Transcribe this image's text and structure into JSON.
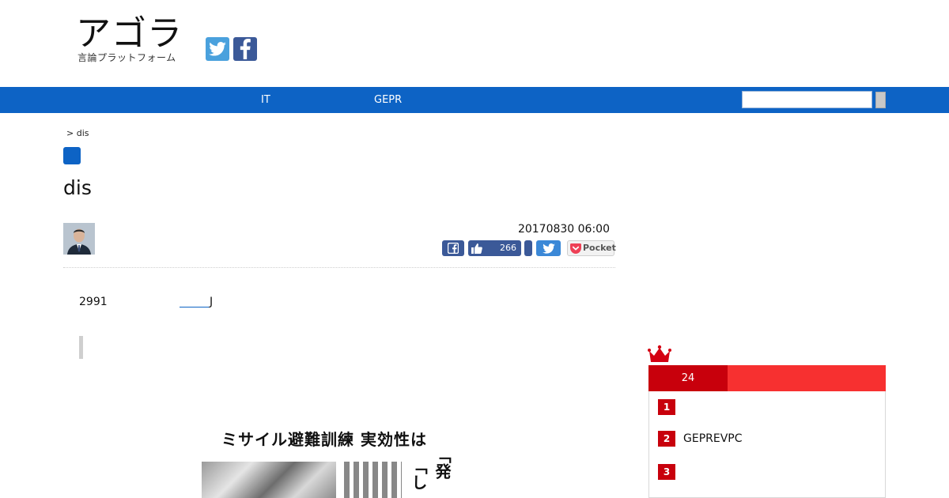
{
  "header": {
    "logo_main": "アゴラ",
    "logo_sub": "言論プラットフォーム",
    "social": [
      "twitter-icon",
      "facebook-icon"
    ]
  },
  "nav": {
    "items": [
      {
        "label": "IT"
      },
      {
        "label": "GEPR"
      }
    ],
    "search_value": ""
  },
  "article": {
    "breadcrumb": "> dis",
    "title": "dis",
    "date": "20170830 06:00",
    "share": {
      "like_count": "266",
      "pocket_label": "Pocket"
    },
    "paragraph": "2991",
    "link_suffix": "J"
  },
  "news_image": {
    "headline": "ミサイル避難訓練 実効性は",
    "big_text_1": "「し",
    "big_text_2": "「発"
  },
  "ranking": {
    "tab_label": "24",
    "items": [
      {
        "num": "1",
        "title": ""
      },
      {
        "num": "2",
        "title": "GEPREVPC"
      },
      {
        "num": "3",
        "title": ""
      }
    ]
  },
  "colors": {
    "brand_blue": "#0d63c5",
    "ranking_red": "#f73030",
    "ranking_dark_red": "#c8000c"
  }
}
